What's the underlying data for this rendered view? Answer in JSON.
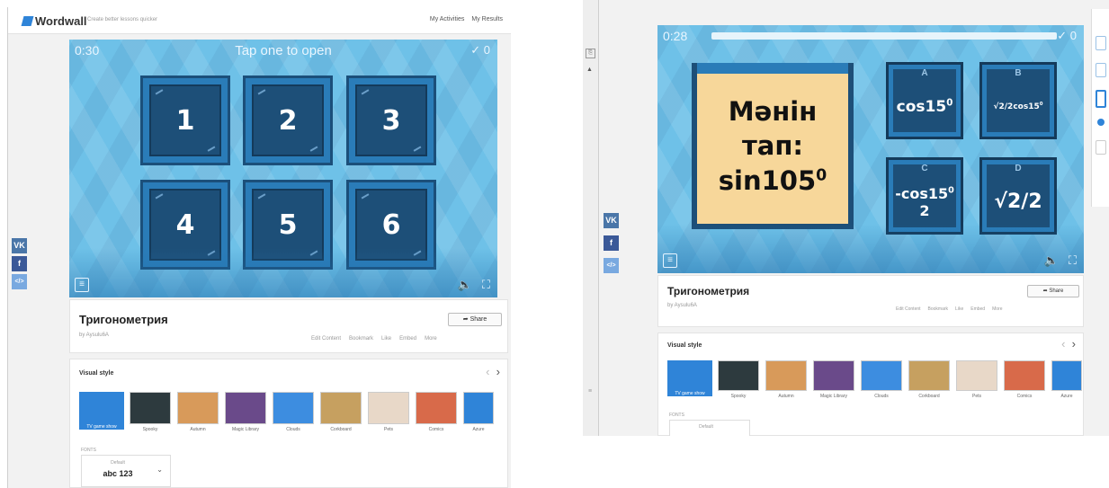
{
  "left": {
    "logo": "Wordwall",
    "tagline": "Create better lessons quicker",
    "nav": [
      "My Activities",
      "My Results"
    ],
    "game": {
      "timer": "0:30",
      "prompt": "Tap one to open",
      "score": "0",
      "tiles": [
        "1",
        "2",
        "3",
        "4",
        "5",
        "6"
      ]
    },
    "social": [
      "VK",
      "f",
      "</>"
    ],
    "activity": {
      "title": "Тригонометрия",
      "author": "by Aysulu6A",
      "share": "Share",
      "actions": [
        "Edit Content",
        "Bookmark",
        "Like",
        "Embed",
        "More"
      ]
    },
    "visual_style": {
      "title": "Visual style",
      "themes": [
        "TV game show",
        "Spooky",
        "Autumn",
        "Magic Library",
        "Clouds",
        "Corkboard",
        "Pets",
        "Comics",
        "Azure"
      ],
      "fonts_label": "FONTS",
      "font_default": "Default",
      "font_sample": "abc 123"
    }
  },
  "right": {
    "game": {
      "timer": "0:28",
      "score": "0",
      "question": [
        "Мәнін",
        "тап:",
        "sin105"
      ],
      "question_sup": "0",
      "answers": [
        {
          "letter": "A",
          "text": "cos15",
          "sup": "0"
        },
        {
          "letter": "B",
          "text": "√2/2cos15",
          "sup": "0"
        },
        {
          "letter": "C",
          "text": "-cos15",
          "sup": "0",
          "line2": "2"
        },
        {
          "letter": "D",
          "text": "√2/2",
          "sup": ""
        }
      ]
    },
    "social": [
      "VK",
      "f",
      "</>"
    ],
    "activity": {
      "title": "Тригонометрия",
      "author": "by Aysulu6A",
      "share": "Share",
      "actions": [
        "Edit Content",
        "Bookmark",
        "Like",
        "Embed",
        "More"
      ]
    },
    "visual_style": {
      "title": "Visual style",
      "themes": [
        "TV game show",
        "Spooky",
        "Autumn",
        "Magic Library",
        "Clouds",
        "Corkboard",
        "Pets",
        "Comics",
        "Azure"
      ],
      "fonts_label": "FONTS",
      "font_default": "Default"
    }
  },
  "colors": {
    "game_bg": "#6ec1e8",
    "tile": "#1d4f78",
    "tile_border": "#2a7cb8",
    "card": "#f7d79a",
    "accent": "#2f84d8",
    "vk": "#4a76a8",
    "facebook": "#3b5998",
    "embed": "#79a9e0"
  }
}
